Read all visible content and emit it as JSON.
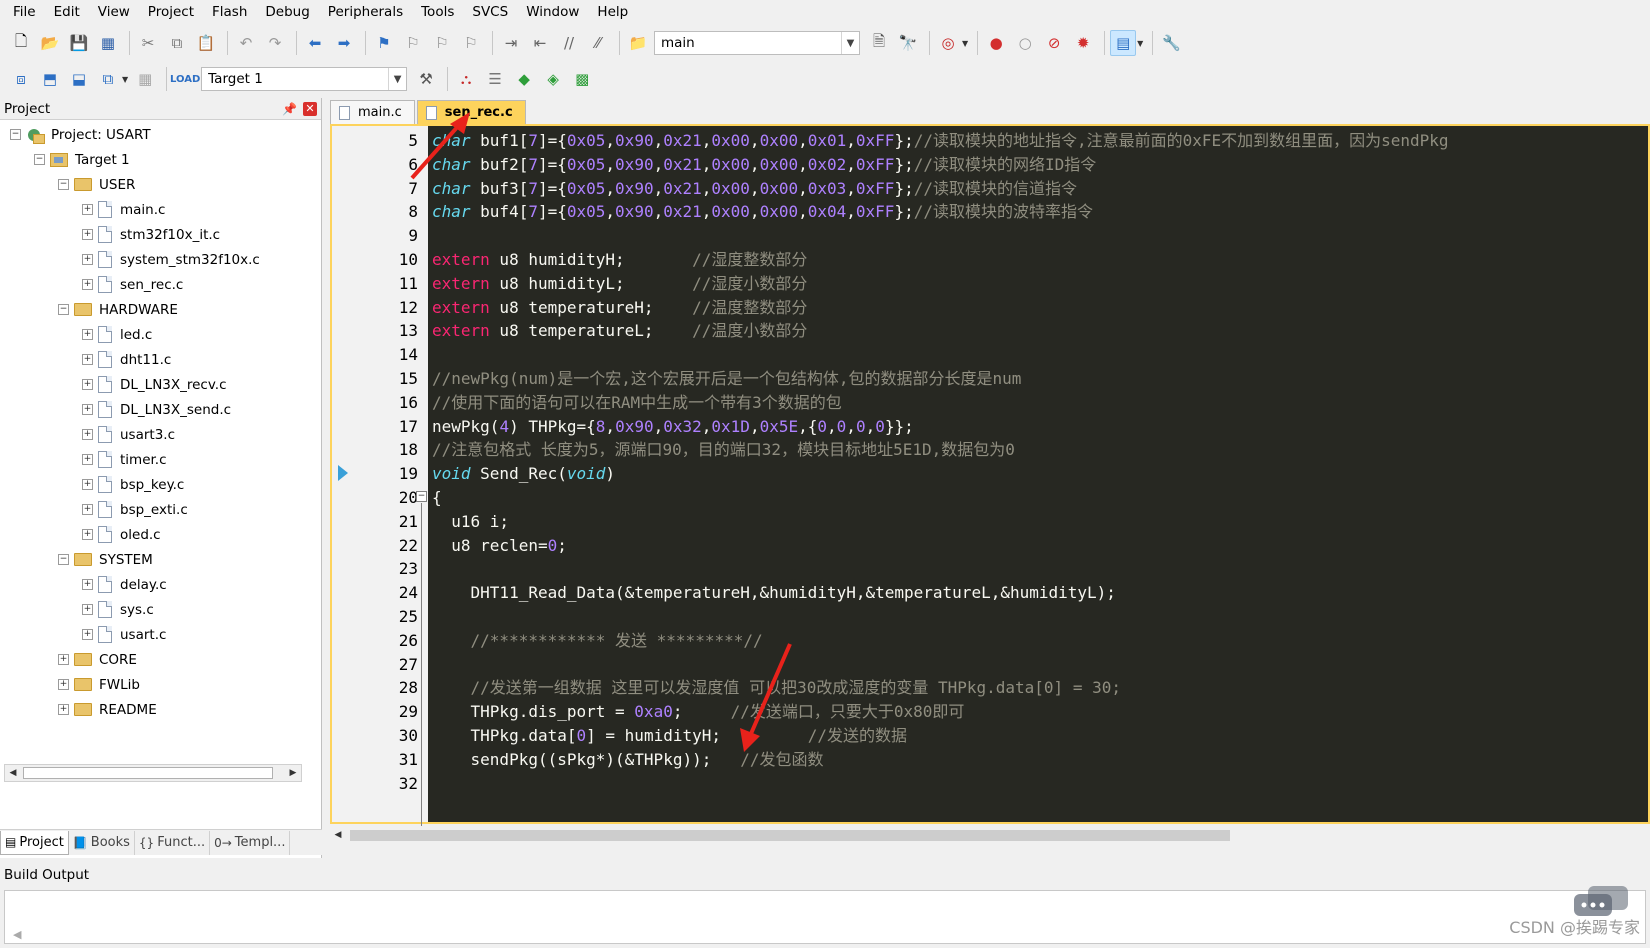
{
  "menu": [
    "File",
    "Edit",
    "View",
    "Project",
    "Flash",
    "Debug",
    "Peripherals",
    "Tools",
    "SVCS",
    "Window",
    "Help"
  ],
  "toolbar1": {
    "combo_value": "main",
    "icons": [
      "new-file-icon",
      "open-folder-icon",
      "save-icon",
      "save-all-icon",
      "cut-icon",
      "copy-icon",
      "paste-icon",
      "undo-icon",
      "redo-icon",
      "nav-back-icon",
      "nav-forward-icon",
      "bookmark-set-icon",
      "bookmark-prev-icon",
      "bookmark-next-icon",
      "bookmark-clear-icon",
      "indent-icon",
      "unindent-icon",
      "comment-icon",
      "uncomment-icon",
      "find-in-files-icon",
      "incremental-find-icon",
      "find-icon",
      "debug-session-icon",
      "breakpoint-icon",
      "breakpoint-disable-icon",
      "breakpoint-disable-all-icon",
      "breakpoint-kill-all-icon",
      "window-layout-icon",
      "configure-icon"
    ]
  },
  "toolbar2": {
    "target_value": "Target 1",
    "icons": [
      "translate-icon",
      "build-icon",
      "rebuild-icon",
      "batch-build-icon",
      "stop-build-icon",
      "download-icon",
      "target-options-icon",
      "manage-components-icon",
      "manage-project-items-icon",
      "select-packs-icon",
      "pack-installer-icon"
    ]
  },
  "project_panel": {
    "title": "Project",
    "tree": [
      {
        "label": "Project: USART",
        "level": 0,
        "kind": "project",
        "expanded": true
      },
      {
        "label": "Target 1",
        "level": 1,
        "kind": "target",
        "expanded": true
      },
      {
        "label": "USER",
        "level": 2,
        "kind": "folder",
        "expanded": true
      },
      {
        "label": "main.c",
        "level": 3,
        "kind": "file"
      },
      {
        "label": "stm32f10x_it.c",
        "level": 3,
        "kind": "file"
      },
      {
        "label": "system_stm32f10x.c",
        "level": 3,
        "kind": "file"
      },
      {
        "label": "sen_rec.c",
        "level": 3,
        "kind": "file"
      },
      {
        "label": "HARDWARE",
        "level": 2,
        "kind": "folder",
        "expanded": true
      },
      {
        "label": "led.c",
        "level": 3,
        "kind": "file"
      },
      {
        "label": "dht11.c",
        "level": 3,
        "kind": "file"
      },
      {
        "label": "DL_LN3X_recv.c",
        "level": 3,
        "kind": "file"
      },
      {
        "label": "DL_LN3X_send.c",
        "level": 3,
        "kind": "file"
      },
      {
        "label": "usart3.c",
        "level": 3,
        "kind": "file"
      },
      {
        "label": "timer.c",
        "level": 3,
        "kind": "file"
      },
      {
        "label": "bsp_key.c",
        "level": 3,
        "kind": "file"
      },
      {
        "label": "bsp_exti.c",
        "level": 3,
        "kind": "file"
      },
      {
        "label": "oled.c",
        "level": 3,
        "kind": "file"
      },
      {
        "label": "SYSTEM",
        "level": 2,
        "kind": "folder",
        "expanded": true
      },
      {
        "label": "delay.c",
        "level": 3,
        "kind": "file"
      },
      {
        "label": "sys.c",
        "level": 3,
        "kind": "file"
      },
      {
        "label": "usart.c",
        "level": 3,
        "kind": "file"
      },
      {
        "label": "CORE",
        "level": 2,
        "kind": "folder",
        "expanded": false
      },
      {
        "label": "FWLib",
        "level": 2,
        "kind": "folder",
        "expanded": false
      },
      {
        "label": "README",
        "level": 2,
        "kind": "folder",
        "expanded": false
      }
    ],
    "bottom_tabs": [
      {
        "label": "Project",
        "icon": "project-tab-icon",
        "active": true
      },
      {
        "label": "Books",
        "icon": "books-tab-icon",
        "active": false
      },
      {
        "label": "Funct...",
        "icon": "functions-tab-icon",
        "active": false
      },
      {
        "label": "Templ...",
        "icon": "templates-tab-icon",
        "active": false
      }
    ]
  },
  "editor": {
    "tabs": [
      {
        "label": "main.c",
        "active": false
      },
      {
        "label": "sen_rec.c",
        "active": true
      }
    ],
    "current_line": 19,
    "fold_line": 20,
    "lines": [
      {
        "n": 5,
        "tokens": [
          [
            "type",
            "char"
          ],
          [
            "plain",
            " buf1["
          ],
          [
            "num",
            "7"
          ],
          [
            "plain",
            "]={"
          ],
          [
            "num",
            "0x05"
          ],
          [
            "plain",
            ","
          ],
          [
            "num",
            "0x90"
          ],
          [
            "plain",
            ","
          ],
          [
            "num",
            "0x21"
          ],
          [
            "plain",
            ","
          ],
          [
            "num",
            "0x00"
          ],
          [
            "plain",
            ","
          ],
          [
            "num",
            "0x00"
          ],
          [
            "plain",
            ","
          ],
          [
            "num",
            "0x01"
          ],
          [
            "plain",
            ","
          ],
          [
            "num",
            "0xFF"
          ],
          [
            "plain",
            "};"
          ],
          [
            "cmt",
            "//读取模块的地址指令,注意最前面的0xFE不加到数组里面，因为sendPkg"
          ]
        ]
      },
      {
        "n": 6,
        "tokens": [
          [
            "type",
            "char"
          ],
          [
            "plain",
            " buf2["
          ],
          [
            "num",
            "7"
          ],
          [
            "plain",
            "]={"
          ],
          [
            "num",
            "0x05"
          ],
          [
            "plain",
            ","
          ],
          [
            "num",
            "0x90"
          ],
          [
            "plain",
            ","
          ],
          [
            "num",
            "0x21"
          ],
          [
            "plain",
            ","
          ],
          [
            "num",
            "0x00"
          ],
          [
            "plain",
            ","
          ],
          [
            "num",
            "0x00"
          ],
          [
            "plain",
            ","
          ],
          [
            "num",
            "0x02"
          ],
          [
            "plain",
            ","
          ],
          [
            "num",
            "0xFF"
          ],
          [
            "plain",
            "};"
          ],
          [
            "cmt",
            "//读取模块的网络ID指令"
          ]
        ]
      },
      {
        "n": 7,
        "tokens": [
          [
            "type",
            "char"
          ],
          [
            "plain",
            " buf3["
          ],
          [
            "num",
            "7"
          ],
          [
            "plain",
            "]={"
          ],
          [
            "num",
            "0x05"
          ],
          [
            "plain",
            ","
          ],
          [
            "num",
            "0x90"
          ],
          [
            "plain",
            ","
          ],
          [
            "num",
            "0x21"
          ],
          [
            "plain",
            ","
          ],
          [
            "num",
            "0x00"
          ],
          [
            "plain",
            ","
          ],
          [
            "num",
            "0x00"
          ],
          [
            "plain",
            ","
          ],
          [
            "num",
            "0x03"
          ],
          [
            "plain",
            ","
          ],
          [
            "num",
            "0xFF"
          ],
          [
            "plain",
            "};"
          ],
          [
            "cmt",
            "//读取模块的信道指令"
          ]
        ]
      },
      {
        "n": 8,
        "tokens": [
          [
            "type",
            "char"
          ],
          [
            "plain",
            " buf4["
          ],
          [
            "num",
            "7"
          ],
          [
            "plain",
            "]={"
          ],
          [
            "num",
            "0x05"
          ],
          [
            "plain",
            ","
          ],
          [
            "num",
            "0x90"
          ],
          [
            "plain",
            ","
          ],
          [
            "num",
            "0x21"
          ],
          [
            "plain",
            ","
          ],
          [
            "num",
            "0x00"
          ],
          [
            "plain",
            ","
          ],
          [
            "num",
            "0x00"
          ],
          [
            "plain",
            ","
          ],
          [
            "num",
            "0x04"
          ],
          [
            "plain",
            ","
          ],
          [
            "num",
            "0xFF"
          ],
          [
            "plain",
            "};"
          ],
          [
            "cmt",
            "//读取模块的波特率指令"
          ]
        ]
      },
      {
        "n": 9,
        "tokens": []
      },
      {
        "n": 10,
        "tokens": [
          [
            "kw",
            "extern"
          ],
          [
            "plain",
            " u8 humidityH;       "
          ],
          [
            "cmt",
            "//湿度整数部分"
          ]
        ]
      },
      {
        "n": 11,
        "tokens": [
          [
            "kw",
            "extern"
          ],
          [
            "plain",
            " u8 humidityL;       "
          ],
          [
            "cmt",
            "//湿度小数部分"
          ]
        ]
      },
      {
        "n": 12,
        "tokens": [
          [
            "kw",
            "extern"
          ],
          [
            "plain",
            " u8 temperatureH;    "
          ],
          [
            "cmt",
            "//温度整数部分"
          ]
        ]
      },
      {
        "n": 13,
        "tokens": [
          [
            "kw",
            "extern"
          ],
          [
            "plain",
            " u8 temperatureL;    "
          ],
          [
            "cmt",
            "//温度小数部分"
          ]
        ]
      },
      {
        "n": 14,
        "tokens": []
      },
      {
        "n": 15,
        "tokens": [
          [
            "cmt",
            "//newPkg(num)是一个宏,这个宏展开后是一个包结构体,包的数据部分长度是num"
          ]
        ]
      },
      {
        "n": 16,
        "tokens": [
          [
            "cmt",
            "//使用下面的语句可以在RAM中生成一个带有3个数据的包"
          ]
        ]
      },
      {
        "n": 17,
        "tokens": [
          [
            "plain",
            "newPkg("
          ],
          [
            "num",
            "4"
          ],
          [
            "plain",
            ") THPkg={"
          ],
          [
            "num",
            "8"
          ],
          [
            "plain",
            ","
          ],
          [
            "num",
            "0x90"
          ],
          [
            "plain",
            ","
          ],
          [
            "num",
            "0x32"
          ],
          [
            "plain",
            ","
          ],
          [
            "num",
            "0x1D"
          ],
          [
            "plain",
            ","
          ],
          [
            "num",
            "0x5E"
          ],
          [
            "plain",
            ",{"
          ],
          [
            "num",
            "0"
          ],
          [
            "plain",
            ","
          ],
          [
            "num",
            "0"
          ],
          [
            "plain",
            ","
          ],
          [
            "num",
            "0"
          ],
          [
            "plain",
            ","
          ],
          [
            "num",
            "0"
          ],
          [
            "plain",
            "}};"
          ]
        ]
      },
      {
        "n": 18,
        "tokens": [
          [
            "cmt",
            "//注意包格式 长度为5，源端口90，目的端口32，模块目标地址5E1D,数据包为0"
          ]
        ]
      },
      {
        "n": 19,
        "tokens": [
          [
            "type",
            "void"
          ],
          [
            "plain",
            " Send_Rec("
          ],
          [
            "type",
            "void"
          ],
          [
            "plain",
            ")"
          ]
        ]
      },
      {
        "n": 20,
        "tokens": [
          [
            "plain",
            "{"
          ]
        ]
      },
      {
        "n": 21,
        "tokens": [
          [
            "plain",
            "  u16 i;"
          ]
        ]
      },
      {
        "n": 22,
        "tokens": [
          [
            "plain",
            "  u8 reclen="
          ],
          [
            "num",
            "0"
          ],
          [
            "plain",
            ";"
          ]
        ]
      },
      {
        "n": 23,
        "tokens": []
      },
      {
        "n": 24,
        "tokens": [
          [
            "plain",
            "    DHT11_Read_Data(&temperatureH,&humidityH,&temperatureL,&humidityL);"
          ]
        ]
      },
      {
        "n": 25,
        "tokens": []
      },
      {
        "n": 26,
        "tokens": [
          [
            "plain",
            "    "
          ],
          [
            "cmt",
            "//************ 发送 *********//"
          ]
        ]
      },
      {
        "n": 27,
        "tokens": []
      },
      {
        "n": 28,
        "tokens": [
          [
            "plain",
            "    "
          ],
          [
            "cmt",
            "//发送第一组数据 这里可以发湿度值 可以把30改成湿度的变量 THPkg.data[0] = 30;"
          ]
        ]
      },
      {
        "n": 29,
        "tokens": [
          [
            "plain",
            "    THPkg.dis_port = "
          ],
          [
            "num",
            "0xa0"
          ],
          [
            "plain",
            ";     "
          ],
          [
            "cmt",
            "//发送端口，只要大于0x80即可"
          ]
        ]
      },
      {
        "n": 30,
        "tokens": [
          [
            "plain",
            "    THPkg.data["
          ],
          [
            "num",
            "0"
          ],
          [
            "plain",
            "] = humidityH;         "
          ],
          [
            "cmt",
            "//发送的数据"
          ]
        ]
      },
      {
        "n": 31,
        "tokens": [
          [
            "plain",
            "    sendPkg((sPkg*)(&THPkg));   "
          ],
          [
            "cmt",
            "//发包函数"
          ]
        ]
      },
      {
        "n": 32,
        "tokens": []
      }
    ]
  },
  "build_output": {
    "title": "Build Output"
  },
  "watermark": {
    "text": "CSDN @挨踢专家"
  },
  "colors": {
    "editor_bg": "#272822",
    "keyword": "#f92672",
    "type": "#66d9ef",
    "number": "#ae81ff",
    "comment": "#908e80",
    "active_tab": "#fdd35c",
    "annotation": "#e8221b"
  }
}
